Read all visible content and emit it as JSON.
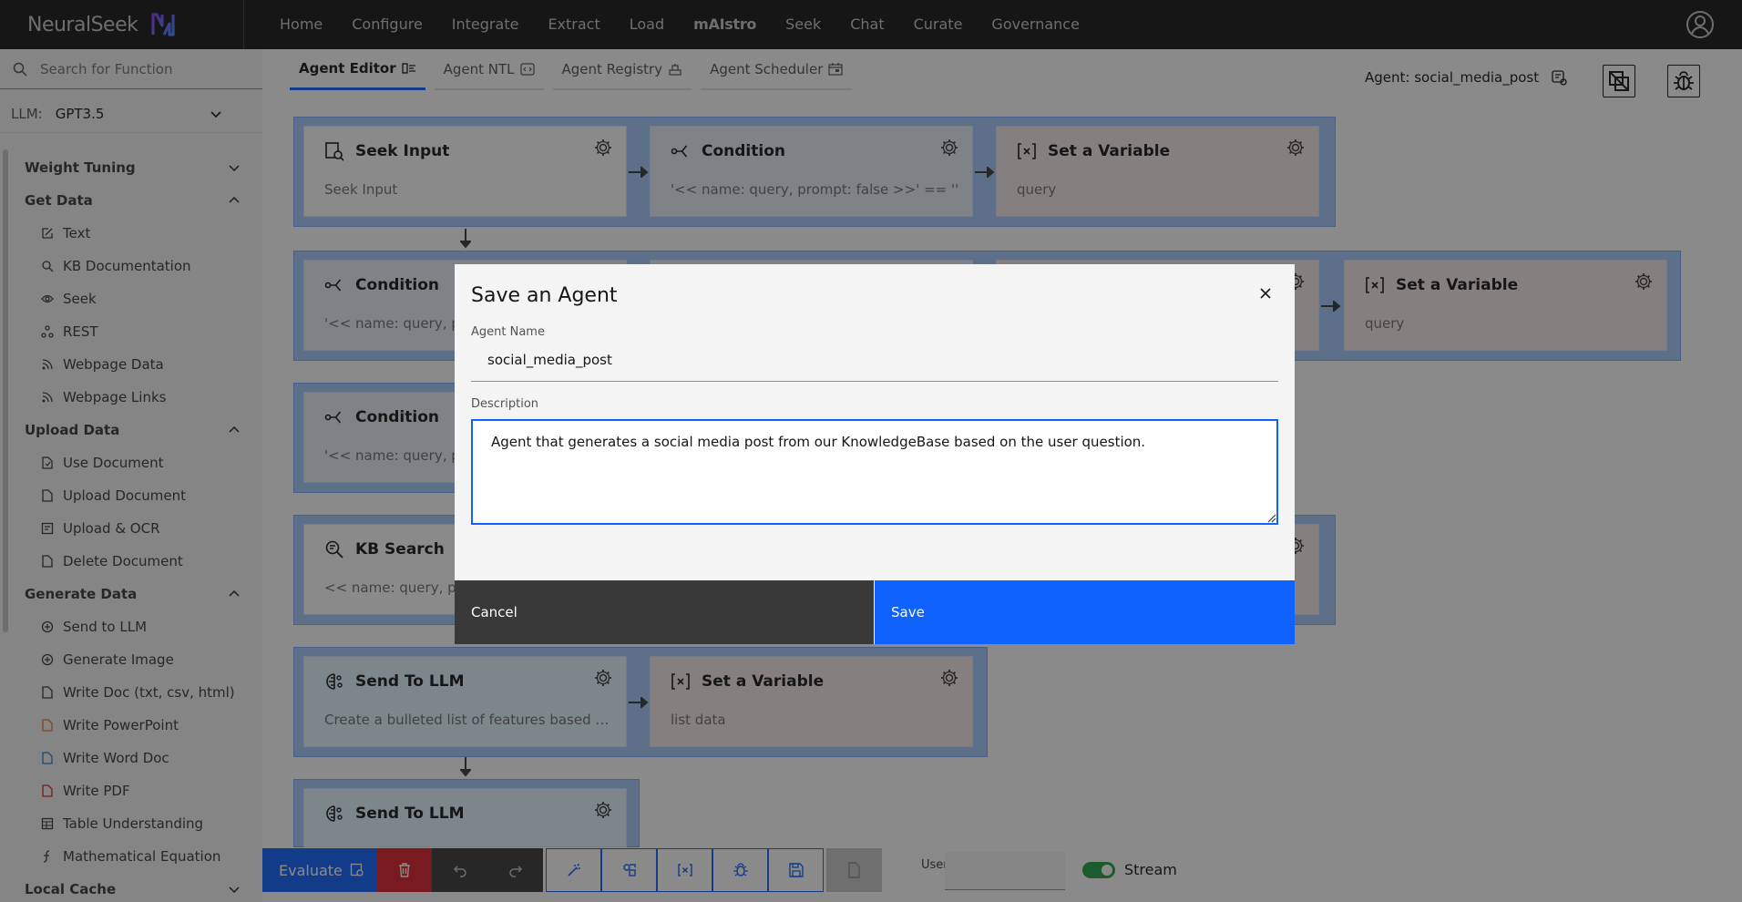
{
  "brand": {
    "name": "NeuralSeek"
  },
  "nav": {
    "items": [
      "Home",
      "Configure",
      "Integrate",
      "Extract",
      "Load",
      "mAIstro",
      "Seek",
      "Chat",
      "Curate",
      "Governance"
    ]
  },
  "sidebar": {
    "search_placeholder": "Search for Function",
    "llm_label": "LLM:",
    "llm_value": "GPT3.5",
    "sections": [
      {
        "title": "Weight Tuning",
        "expanded": false,
        "items": []
      },
      {
        "title": "Get Data",
        "expanded": true,
        "items": [
          {
            "label": "Text",
            "icon": "edit-icon"
          },
          {
            "label": "KB Documentation",
            "icon": "doc-search-icon"
          },
          {
            "label": "Seek",
            "icon": "eye-icon"
          },
          {
            "label": "REST",
            "icon": "api-icon"
          },
          {
            "label": "Webpage Data",
            "icon": "rss-icon"
          },
          {
            "label": "Webpage Links",
            "icon": "rss-icon"
          }
        ]
      },
      {
        "title": "Upload Data",
        "expanded": true,
        "items": [
          {
            "label": "Use Document",
            "icon": "doc-use-icon"
          },
          {
            "label": "Upload Document",
            "icon": "doc-icon"
          },
          {
            "label": "Upload & OCR",
            "icon": "ocr-icon"
          },
          {
            "label": "Delete Document",
            "icon": "doc-icon"
          }
        ]
      },
      {
        "title": "Generate Data",
        "expanded": true,
        "items": [
          {
            "label": "Send to LLM",
            "icon": "ai-icon"
          },
          {
            "label": "Generate Image",
            "icon": "ai-icon"
          },
          {
            "label": "Write Doc (txt, csv, html)",
            "icon": "doc-icon"
          },
          {
            "label": "Write PowerPoint",
            "icon": "ppt-icon"
          },
          {
            "label": "Write Word Doc",
            "icon": "word-icon"
          },
          {
            "label": "Write PDF",
            "icon": "pdf-icon"
          },
          {
            "label": "Table Understanding",
            "icon": "table-icon"
          },
          {
            "label": "Mathematical Equation",
            "icon": "function-icon"
          }
        ]
      },
      {
        "title": "Local Cache",
        "expanded": false,
        "items": []
      }
    ]
  },
  "tabs": [
    {
      "label": "Agent Editor",
      "active": true
    },
    {
      "label": "Agent NTL",
      "active": false
    },
    {
      "label": "Agent Registry",
      "active": false
    },
    {
      "label": "Agent Scheduler",
      "active": false
    }
  ],
  "agent_label": "Agent: social_media_post",
  "canvas": {
    "nodes": [
      {
        "title": "Seek Input",
        "sub": "Seek Input"
      },
      {
        "title": "Condition",
        "sub": "'<< name: query, prompt: false >>' == ''"
      },
      {
        "title": "Set a Variable",
        "sub": "query"
      },
      {
        "title": "Condition",
        "sub": "'<< name: query, prompt: false >>' == ''"
      },
      {
        "title": "Set a Variable",
        "sub": "query"
      },
      {
        "title": "Condition",
        "sub": "'<< name: query, prompt: false >>' == ''"
      },
      {
        "title": "KB Search",
        "sub": "<< name: query, prompt: false >>"
      },
      {
        "title": "Send To LLM",
        "sub": "Create a bulleted list of features based on the above"
      },
      {
        "title": "Set a Variable",
        "sub": "list  data"
      },
      {
        "title": "Send To LLM",
        "sub": ""
      }
    ]
  },
  "modal": {
    "title": "Save an Agent",
    "name_label": "Agent Name",
    "name_value": "social_media_post",
    "desc_label": "Description",
    "desc_value": "Agent that generates a social media post from our KnowledgeBase based on the user question.",
    "cancel": "Cancel",
    "save": "Save"
  },
  "toolbar": {
    "evaluate": "Evaluate",
    "userid_label": "User Id",
    "userid_value": "",
    "stream_label": "Stream",
    "stream_on": true
  },
  "colors": {
    "primary": "#0f62fe",
    "danger": "#da1e28",
    "success": "#24a148",
    "nav_bg": "#161616"
  }
}
